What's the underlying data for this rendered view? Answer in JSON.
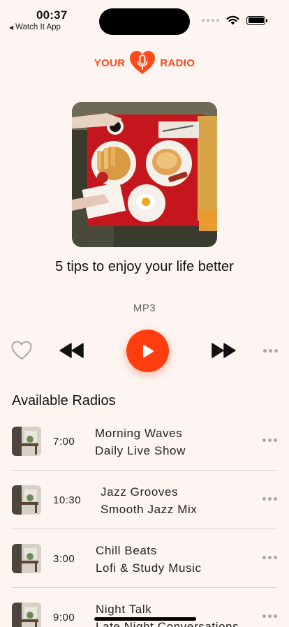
{
  "status_bar": {
    "time": "00:37",
    "back_app": "Watch It App"
  },
  "logo": {
    "left_text": "YOUR",
    "right_text": "RADIO",
    "icon": "heart-microphone-icon",
    "brand_color": "#ff4a1a"
  },
  "now_playing": {
    "cover_icon": "food-photo",
    "title": "5 tips to enjoy your life better",
    "format": "MP3"
  },
  "controls": {
    "favorite_icon": "heart-outline-icon",
    "rewind_icon": "rewind-icon",
    "play_icon": "play-icon",
    "forward_icon": "fast-forward-icon",
    "more_icon": "more-dots-icon",
    "accent": "#ff3d0e"
  },
  "available_radios": {
    "title": "Available Radios",
    "items": [
      {
        "time": "7:00",
        "name": "Morning Waves",
        "description": "Daily Live Show"
      },
      {
        "time": "10:30",
        "name": "Jazz Grooves",
        "description": "Smooth Jazz Mix"
      },
      {
        "time": "3:00",
        "name": "Chill Beats",
        "description": "Lofi & Study Music"
      },
      {
        "time": "9:00",
        "name": "Night Talk",
        "description": "Late Night Conversations"
      }
    ]
  }
}
